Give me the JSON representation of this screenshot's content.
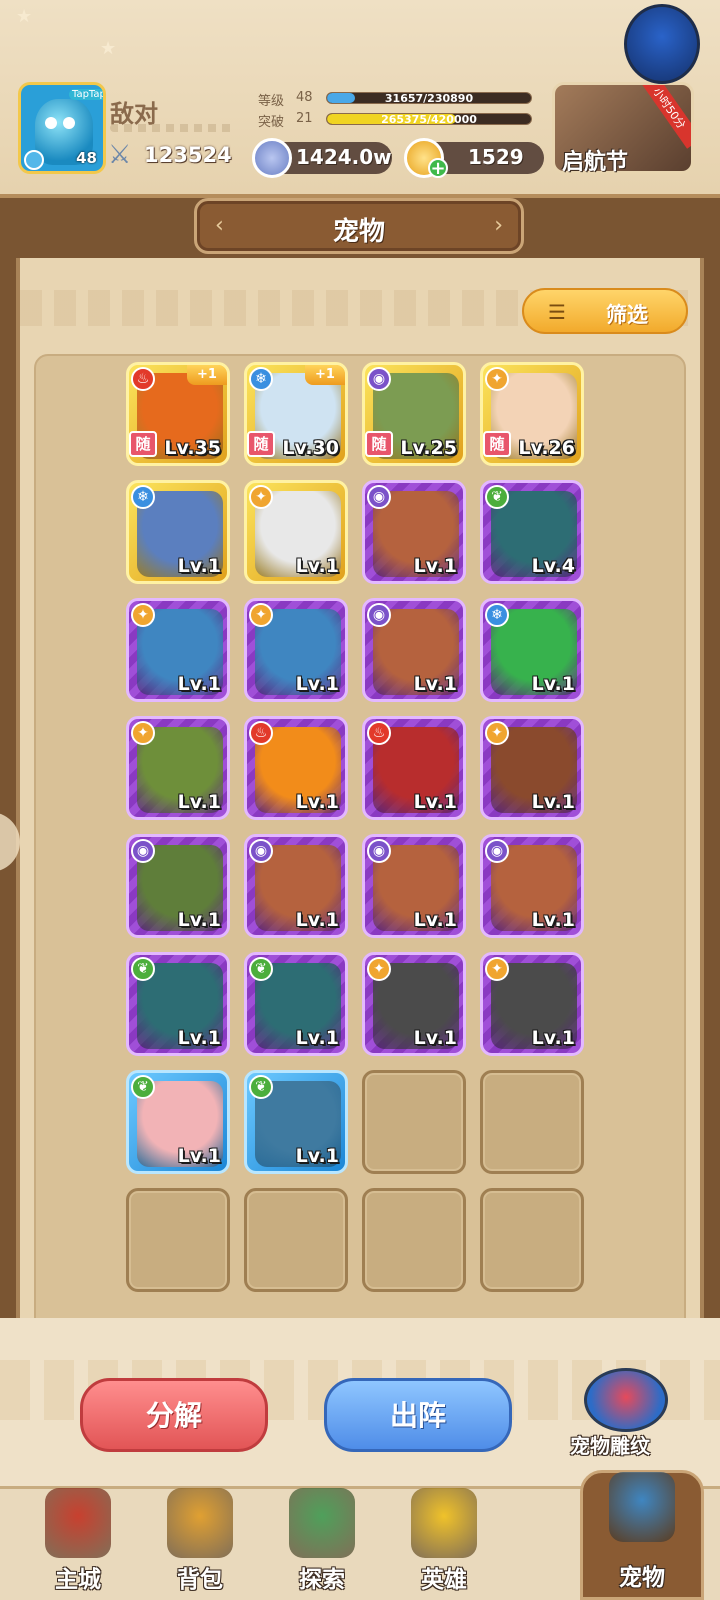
{
  "header": {
    "player_name": "敌对",
    "avatar_level": "48",
    "avatar_platform": "TapTap",
    "power": "123524",
    "level_label": "等级",
    "level_value": "48",
    "level_bar_text": "31657/230890",
    "level_progress": 0.137,
    "break_label": "突破",
    "break_value": "21",
    "break_bar_text": "265375/420000",
    "break_progress": 0.632,
    "silver_amount": "1424.0w",
    "gold_amount": "1529",
    "event_title": "启航节",
    "event_ribbon": "小时50分"
  },
  "page": {
    "title": "宠物",
    "filter_label": "筛选"
  },
  "pets": [
    {
      "level": "Lv.35",
      "element": "fire",
      "rarity": "gold",
      "follow": "随",
      "plus": "+1",
      "face": "#e66a1d"
    },
    {
      "level": "Lv.30",
      "element": "ice",
      "rarity": "gold",
      "follow": "随",
      "plus": "+1",
      "face": "#cfe3f2"
    },
    {
      "level": "Lv.25",
      "element": "eye",
      "rarity": "gold",
      "follow": "随",
      "plus": "",
      "face": "#7c9c52"
    },
    {
      "level": "Lv.26",
      "element": "light",
      "rarity": "gold",
      "follow": "随",
      "plus": "",
      "face": "#f3d3b6"
    },
    {
      "level": "Lv.1",
      "element": "ice",
      "rarity": "gold",
      "follow": "",
      "plus": "",
      "face": "#5b7fbf"
    },
    {
      "level": "Lv.1",
      "element": "light",
      "rarity": "gold",
      "follow": "",
      "plus": "",
      "face": "#e8e8e8"
    },
    {
      "level": "Lv.1",
      "element": "eye",
      "rarity": "purple",
      "follow": "",
      "plus": "",
      "face": "#b5623e"
    },
    {
      "level": "Lv.4",
      "element": "nature",
      "rarity": "purple",
      "follow": "",
      "plus": "",
      "face": "#2d6d74"
    },
    {
      "level": "Lv.1",
      "element": "light",
      "rarity": "purple",
      "follow": "",
      "plus": "",
      "face": "#3f86c1"
    },
    {
      "level": "Lv.1",
      "element": "light",
      "rarity": "purple",
      "follow": "",
      "plus": "",
      "face": "#3f86c1"
    },
    {
      "level": "Lv.1",
      "element": "eye",
      "rarity": "purple",
      "follow": "",
      "plus": "",
      "face": "#b5623e"
    },
    {
      "level": "Lv.1",
      "element": "ice",
      "rarity": "purple",
      "follow": "",
      "plus": "",
      "face": "#37b24d"
    },
    {
      "level": "Lv.1",
      "element": "light",
      "rarity": "purple",
      "follow": "",
      "plus": "",
      "face": "#6e8f3a"
    },
    {
      "level": "Lv.1",
      "element": "fire",
      "rarity": "purple",
      "follow": "",
      "plus": "",
      "face": "#f28c1a"
    },
    {
      "level": "Lv.1",
      "element": "fire",
      "rarity": "purple",
      "follow": "",
      "plus": "",
      "face": "#b82d2d"
    },
    {
      "level": "Lv.1",
      "element": "light",
      "rarity": "purple",
      "follow": "",
      "plus": "",
      "face": "#8a4a2d"
    },
    {
      "level": "Lv.1",
      "element": "eye",
      "rarity": "purple",
      "follow": "",
      "plus": "",
      "face": "#5f7e3a"
    },
    {
      "level": "Lv.1",
      "element": "eye",
      "rarity": "purple",
      "follow": "",
      "plus": "",
      "face": "#b5623e"
    },
    {
      "level": "Lv.1",
      "element": "eye",
      "rarity": "purple",
      "follow": "",
      "plus": "",
      "face": "#b5623e"
    },
    {
      "level": "Lv.1",
      "element": "eye",
      "rarity": "purple",
      "follow": "",
      "plus": "",
      "face": "#b5623e"
    },
    {
      "level": "Lv.1",
      "element": "nature",
      "rarity": "purple",
      "follow": "",
      "plus": "",
      "face": "#2d6d74"
    },
    {
      "level": "Lv.1",
      "element": "nature",
      "rarity": "purple",
      "follow": "",
      "plus": "",
      "face": "#2d6d74"
    },
    {
      "level": "Lv.1",
      "element": "light",
      "rarity": "purple",
      "follow": "",
      "plus": "",
      "face": "#4b4b4b"
    },
    {
      "level": "Lv.1",
      "element": "light",
      "rarity": "purple",
      "follow": "",
      "plus": "",
      "face": "#4b4b4b"
    },
    {
      "level": "Lv.1",
      "element": "nature",
      "rarity": "blue",
      "follow": "",
      "plus": "",
      "face": "#f2b3b6"
    },
    {
      "level": "Lv.1",
      "element": "nature",
      "rarity": "blue",
      "follow": "",
      "plus": "",
      "face": "#3f7aa0"
    }
  ],
  "element_colors": {
    "fire": "#e23a2a",
    "ice": "#3a8fe0",
    "eye": "#7b52c9",
    "light": "#f0a530",
    "nature": "#4cae3c"
  },
  "element_icons": {
    "fire": "fire-icon",
    "ice": "snowflake-icon",
    "eye": "eye-icon",
    "light": "sun-icon",
    "nature": "leaf-icon"
  },
  "actions": {
    "decompose_label": "分解",
    "deploy_label": "出阵",
    "carve_label": "宠物雕纹"
  },
  "nav": {
    "items": [
      {
        "label": "主城",
        "icon": "castle-icon",
        "color": "#c8402f"
      },
      {
        "label": "背包",
        "icon": "backpack-icon",
        "color": "#e0a032"
      },
      {
        "label": "探索",
        "icon": "map-icon",
        "color": "#4fa05b"
      },
      {
        "label": "英雄",
        "icon": "hero-icon",
        "color": "#f0c22a"
      },
      {
        "label": "宠物",
        "icon": "pet-icon",
        "color": "#3f86c1"
      }
    ]
  }
}
